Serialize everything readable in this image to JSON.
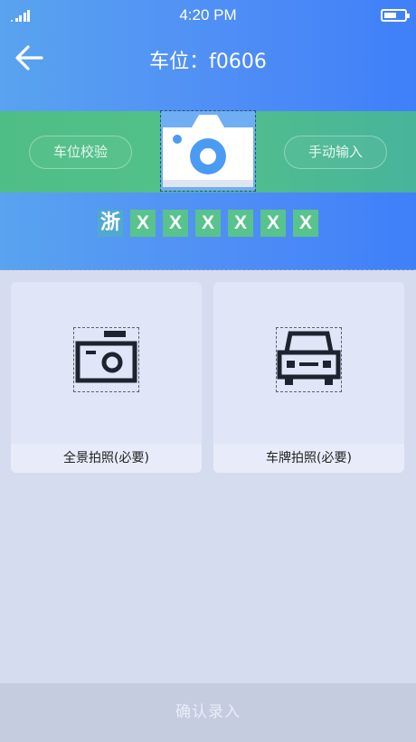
{
  "status_bar": {
    "time": "4:20 PM",
    "signal_icon": "signal-bars-icon",
    "battery_icon": "battery-icon"
  },
  "header": {
    "back_icon": "arrow-left-icon",
    "title": "车位：f0606"
  },
  "capture": {
    "verify_label": "车位校验",
    "manual_label": "手动输入",
    "camera_icon": "camera-icon"
  },
  "plate": {
    "province": "浙",
    "chars": [
      "X",
      "X",
      "X",
      "X",
      "X",
      "X"
    ]
  },
  "photo_cards": [
    {
      "label": "全景拍照(必要)",
      "icon": "camera-icon"
    },
    {
      "label": "车牌拍照(必要)",
      "icon": "car-icon"
    }
  ],
  "confirm_label": "确认录入",
  "colors": {
    "header_blue": "#4f8ef6",
    "band_green": "#53c08a",
    "plate_green": "#58c38c",
    "page_bg": "#d6dcf0"
  }
}
